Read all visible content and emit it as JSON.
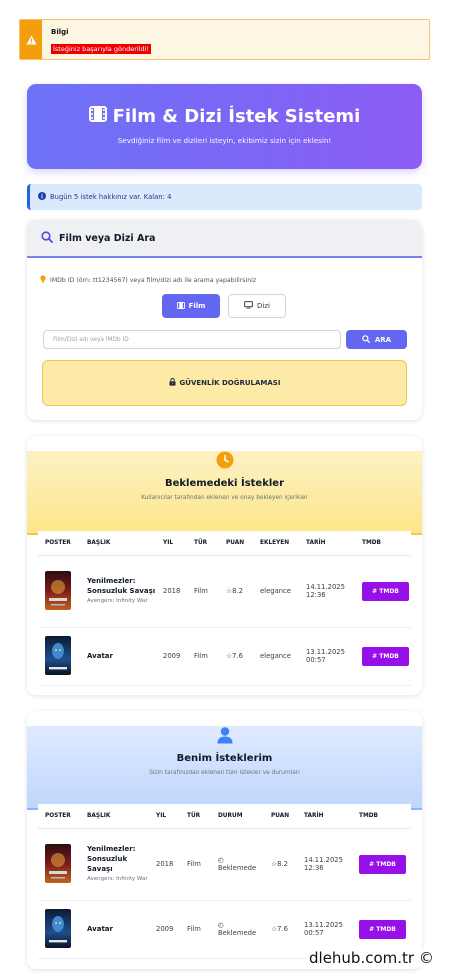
{
  "alert": {
    "title": "Bilgi",
    "message": "İsteğiniz başarıyla gönderildi!"
  },
  "hero": {
    "title": "Film & Dizi İstek Sistemi",
    "subtitle": "Sevdiğiniz film ve dizileri isteyin, ekibimiz sizin için eklesin!"
  },
  "quota": {
    "text": "Bugün 5 istek hakkınız var. Kalan: 4"
  },
  "search": {
    "title": "Film veya Dizi Ara",
    "hint": "IMDb ID (örn: tt1234567) veya film/dizi adı ile arama yapabilirsiniz",
    "type_film": "Film",
    "type_dizi": "Dizi",
    "placeholder": "Film/Dizi adı veya IMDb ID",
    "button": "ARA",
    "captcha": "GÜVENLİK DOĞRULAMASI"
  },
  "pending": {
    "title": "Beklemedeki İstekler",
    "subtitle": "Kullanıcılar tarafından eklenen ve onay bekleyen içerikler",
    "columns": [
      "POSTER",
      "BAŞLIK",
      "YIL",
      "TÜR",
      "PUAN",
      "EKLEYEN",
      "TARİH",
      "TMDB"
    ],
    "rows": [
      {
        "title": "Yenilmezler: Sonsuzluk Savaşı",
        "original": "Avengers: Infinity War",
        "year": "2018",
        "type": "Film",
        "rating": "8.2",
        "added_by": "elegance",
        "date": "14.11.2025",
        "time": "12:36",
        "tmdb": "TMDB"
      },
      {
        "title": "Avatar",
        "original": "",
        "year": "2009",
        "type": "Film",
        "rating": "7.6",
        "added_by": "elegance",
        "date": "13.11.2025",
        "time": "00:57",
        "tmdb": "TMDB"
      }
    ]
  },
  "mine": {
    "title": "Benim İsteklerim",
    "subtitle": "Sizin tarafınızdan eklenen tüm istekler ve durumları",
    "columns": [
      "POSTER",
      "BAŞLIK",
      "YIL",
      "TÜR",
      "DURUM",
      "PUAN",
      "TARİH",
      "TMDB"
    ],
    "rows": [
      {
        "title": "Yenilmezler: Sonsuzluk Savaşı",
        "original": "Avengers: Infinity War",
        "year": "2018",
        "type": "Film",
        "status": "Beklemede",
        "rating": "8.2",
        "date": "14.11.2025",
        "time": "12:36",
        "tmdb": "TMDB"
      },
      {
        "title": "Avatar",
        "original": "",
        "year": "2009",
        "type": "Film",
        "status": "Beklemede",
        "rating": "7.6",
        "date": "13.11.2025",
        "time": "00:57",
        "tmdb": "TMDB"
      }
    ]
  },
  "watermark": "dlehub.com.tr ©",
  "colors": {
    "accent": "#6366f1",
    "tmdb": "#9810e8",
    "warning": "#f59e0b",
    "info": "#2563eb"
  }
}
